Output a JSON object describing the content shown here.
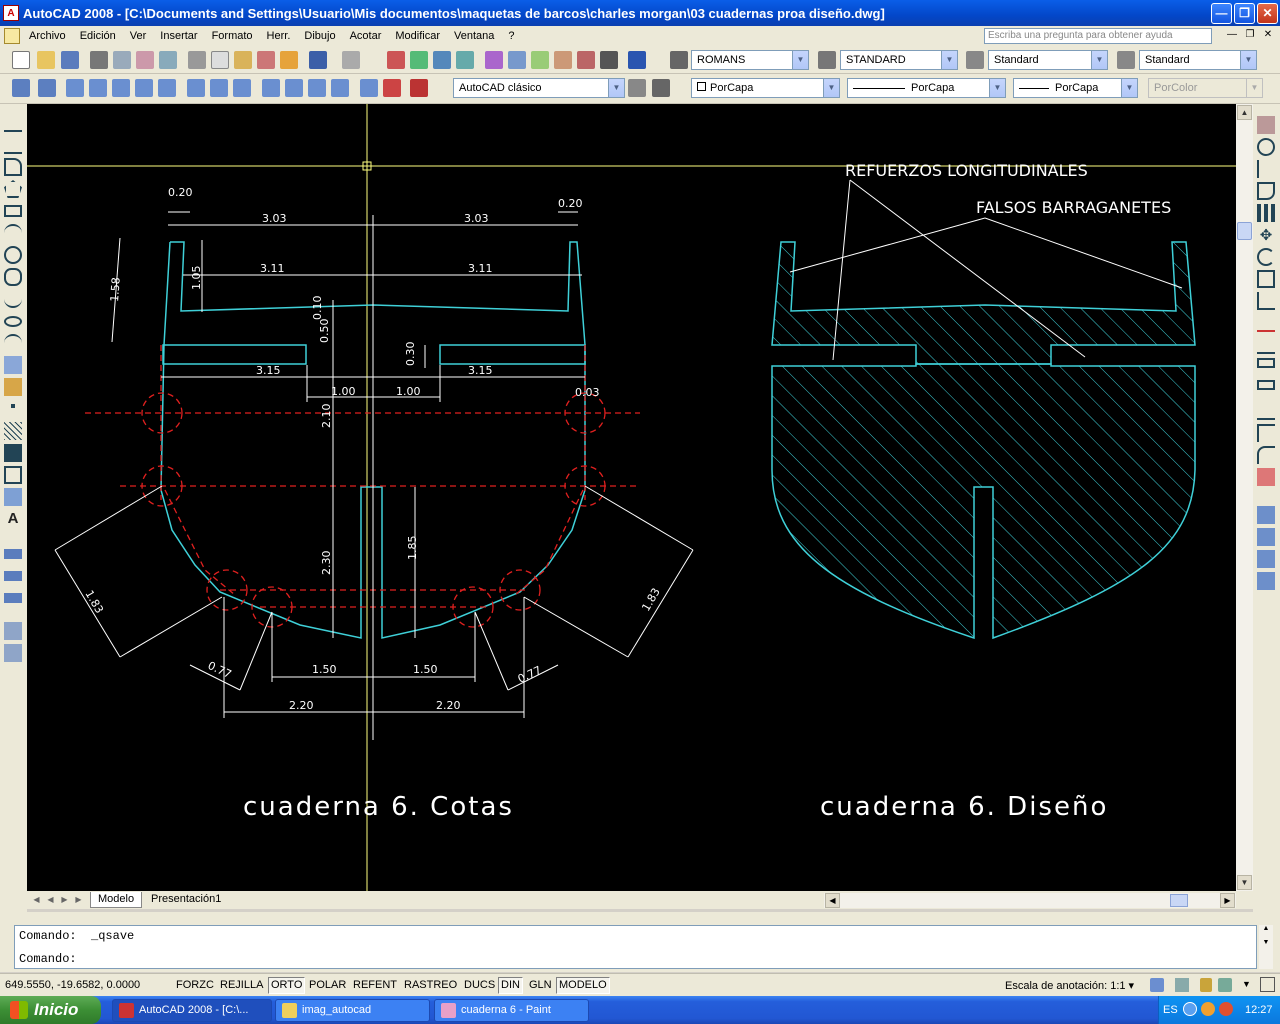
{
  "window": {
    "title": "AutoCAD 2008 - [C:\\Documents and Settings\\Usuario\\Mis documentos\\maquetas de barcos\\charles morgan\\03 cuadernas proa diseño.dwg]",
    "app_icon": "A"
  },
  "menu": {
    "items": [
      "Archivo",
      "Edición",
      "Ver",
      "Insertar",
      "Formato",
      "Herr.",
      "Dibujo",
      "Acotar",
      "Modificar",
      "Ventana",
      "?"
    ],
    "help_placeholder": "Escriba una pregunta para obtener ayuda"
  },
  "styles_toolbar": {
    "text_style": "ROMANS",
    "dim_style": "STANDARD",
    "table_style": "Standard",
    "multileader_style": "Standard"
  },
  "workspace": {
    "name": "AutoCAD clásico"
  },
  "properties": {
    "color": "PorCapa",
    "linetype": "PorCapa",
    "lineweight": "PorCapa",
    "plotstyle": "PorColor"
  },
  "drawing": {
    "left_title": "cuaderna 6. Cotas",
    "right_title": "cuaderna 6. Diseño",
    "label_refuerzos": "REFUERZOS LONGITUDINALES",
    "label_falsos": "FALSOS BARRAGANETES",
    "dims": {
      "d020_left": "0.20",
      "d020_right": "0.20",
      "d303_left": "3.03",
      "d303_right": "3.03",
      "d311_left": "3.11",
      "d311_right": "3.11",
      "d158": "1.58",
      "d105": "1.05",
      "d010": "0.10",
      "d050": "0.50",
      "d030": "0.30",
      "d315_left": "3.15",
      "d315_right": "3.15",
      "d100_left": "1.00",
      "d100_right": "1.00",
      "d003": "0.03",
      "d210": "2.10",
      "d230": "2.30",
      "d185": "1.85",
      "d183_left": "1.83",
      "d183_right": "1.83",
      "d077_left": "0.77",
      "d077_right": "0.77",
      "d150_left": "1.50",
      "d150_right": "1.50",
      "d220_left": "2.20",
      "d220_right": "2.20"
    },
    "colors": {
      "background": "#000000",
      "outline": "#3fd0d8",
      "red": "#e0201f",
      "white": "#ffffff",
      "crosshair": "#ffff80"
    }
  },
  "layout_tabs": [
    "Modelo",
    "Presentación1"
  ],
  "command": {
    "history_line": "Comando:  _qsave",
    "prompt": "Comando:"
  },
  "status": {
    "coordinates": "649.5550, -19.6582, 0.0000",
    "toggles": [
      {
        "label": "FORZC",
        "on": false
      },
      {
        "label": "REJILLA",
        "on": false
      },
      {
        "label": "ORTO",
        "on": true
      },
      {
        "label": "POLAR",
        "on": false
      },
      {
        "label": "REFENT",
        "on": false
      },
      {
        "label": "RASTREO",
        "on": false
      },
      {
        "label": "DUCS",
        "on": false
      },
      {
        "label": "DIN",
        "on": true
      },
      {
        "label": "GLN",
        "on": false
      },
      {
        "label": "MODELO",
        "on": true
      }
    ],
    "annotation_scale_label": "Escala de anotación:",
    "annotation_scale": "1:1"
  },
  "taskbar": {
    "start": "Inicio",
    "tasks": [
      {
        "label": "AutoCAD 2008 - [C:\\...",
        "active": true
      },
      {
        "label": "imag_autocad",
        "active": false
      },
      {
        "label": "cuaderna 6 - Paint",
        "active": false
      }
    ],
    "language": "ES",
    "clock": "12:27"
  }
}
